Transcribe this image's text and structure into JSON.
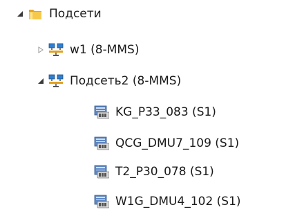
{
  "tree": {
    "root": {
      "label": "Подсети",
      "icon": "folder-icon",
      "expanded": true
    },
    "subnets": [
      {
        "label": "w1 (8-MMS)",
        "icon": "network-icon",
        "expanded": false
      },
      {
        "label": "Подсеть2 (8-MMS)",
        "icon": "network-icon",
        "expanded": true
      }
    ],
    "stations": [
      {
        "label": "KG_P33_083 (S1)",
        "icon": "station-icon"
      },
      {
        "label": "QCG_DMU7_109 (S1)",
        "icon": "station-icon"
      },
      {
        "label": "T2_P30_078 (S1)",
        "icon": "station-icon"
      },
      {
        "label": "W1G_DMU4_102 (S1)",
        "icon": "station-icon"
      }
    ]
  }
}
